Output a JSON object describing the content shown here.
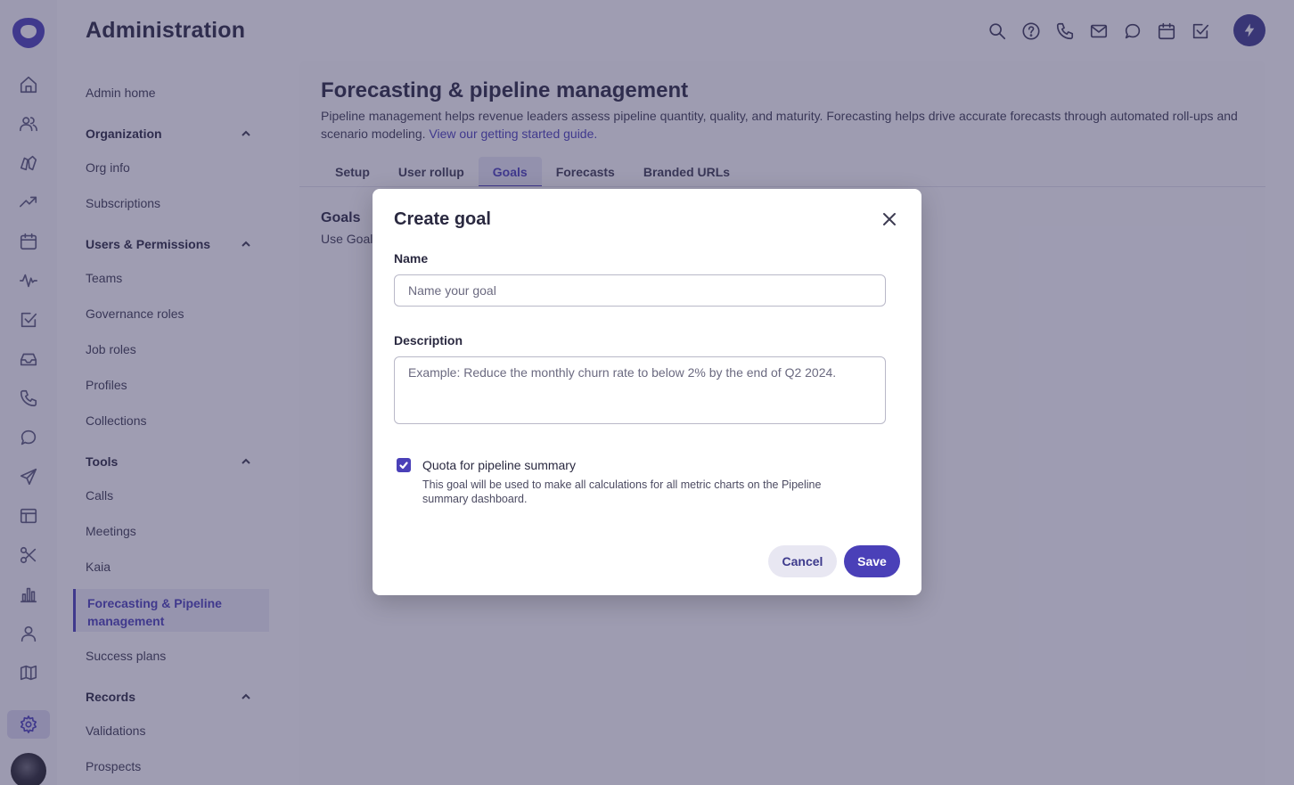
{
  "header": {
    "title": "Administration",
    "icons": [
      "search-icon",
      "help-icon",
      "phone-icon",
      "mail-icon",
      "chat-icon",
      "calendar-icon",
      "tasks-icon"
    ],
    "action_icon": "lightning-icon"
  },
  "rail": {
    "icons": [
      "home-icon",
      "people-icon",
      "deals-icon",
      "trending-icon",
      "calendar-icon",
      "activity-icon",
      "tasks-icon",
      "inbox-icon",
      "phone-icon",
      "chat-icon",
      "send-icon",
      "layout-icon",
      "scissors-icon",
      "bar-chart-icon",
      "person-icon",
      "map-icon",
      "settings-icon"
    ],
    "active": "settings-icon"
  },
  "subnav": {
    "admin_home": "Admin home",
    "sections": [
      {
        "title": "Organization",
        "items": [
          "Org info",
          "Subscriptions"
        ]
      },
      {
        "title": "Users & Permissions",
        "items": [
          "Teams",
          "Governance roles",
          "Job roles",
          "Profiles",
          "Collections"
        ]
      },
      {
        "title": "Tools",
        "items": [
          "Calls",
          "Meetings",
          "Kaia",
          "Forecasting & Pipeline management",
          "Success plans"
        ]
      },
      {
        "title": "Records",
        "items": [
          "Validations",
          "Prospects"
        ]
      }
    ],
    "active_item": "Forecasting & Pipeline management"
  },
  "main": {
    "title": "Forecasting & pipeline management",
    "description": "Pipeline management helps revenue leaders assess pipeline quantity, quality, and maturity. Forecasting helps drive accurate forecasts through automated roll-ups and scenario modeling.",
    "link": "View our getting started guide.",
    "tabs": [
      "Setup",
      "User rollup",
      "Goals",
      "Forecasts",
      "Branded URLs"
    ],
    "active_tab": "Goals",
    "section_title": "Goals",
    "section_text": "Use Goals"
  },
  "modal": {
    "title": "Create goal",
    "name_label": "Name",
    "name_placeholder": "Name your goal",
    "description_label": "Description",
    "description_placeholder": "Example: Reduce the monthly churn rate to below 2% by the end of Q2 2024.",
    "checkbox_checked": true,
    "checkbox_label": "Quota for pipeline summary",
    "checkbox_help": "This goal will be used to make all calculations for all metric charts on the Pipeline summary dashboard.",
    "cancel": "Cancel",
    "save": "Save"
  },
  "colors": {
    "accent": "#4a40b8",
    "overlay": "#37325f",
    "text": "#2a2940"
  }
}
